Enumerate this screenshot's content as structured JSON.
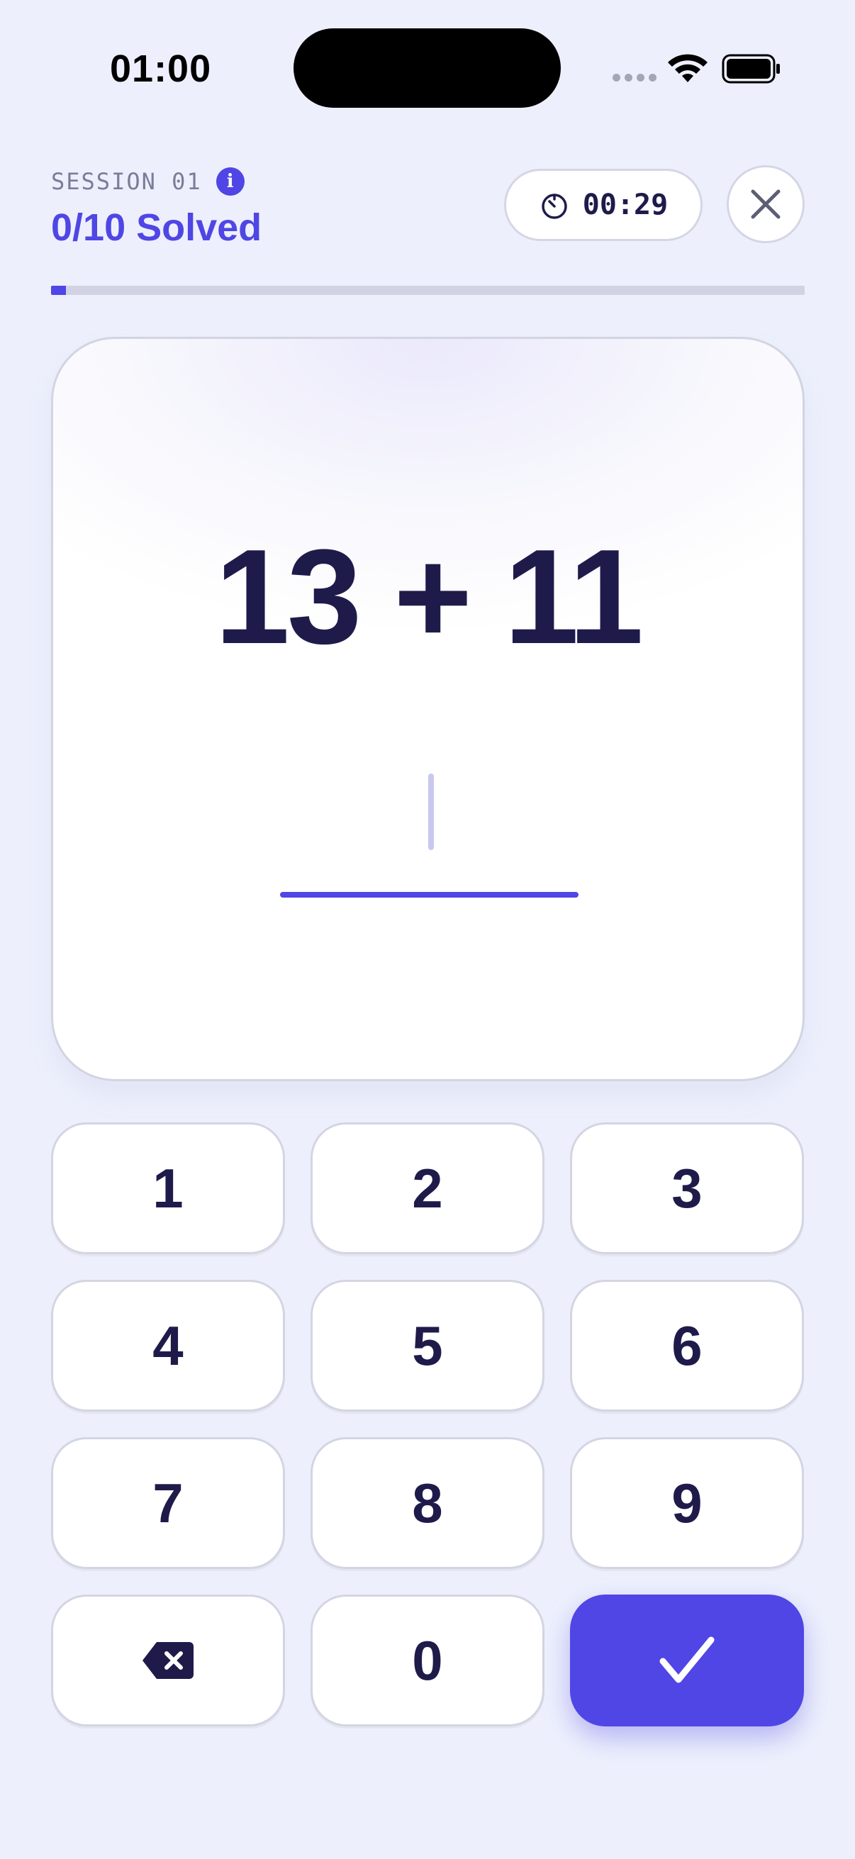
{
  "status_bar": {
    "time": "01:00",
    "icons": [
      "cellular-signal-icon",
      "wifi-icon",
      "battery-icon"
    ]
  },
  "header": {
    "session_label": "SESSION 01",
    "info_icon": "i",
    "solved_text": "0/10 Solved",
    "timer": "00:29",
    "close_icon": "close-icon"
  },
  "progress": {
    "fraction": 0.02
  },
  "problem": {
    "expression": "13 + 11",
    "answer_value": ""
  },
  "keypad": {
    "keys": [
      "1",
      "2",
      "3",
      "4",
      "5",
      "6",
      "7",
      "8",
      "9"
    ],
    "zero": "0",
    "backspace_icon": "backspace-icon",
    "submit_icon": "checkmark-icon"
  },
  "colors": {
    "accent": "#4f46e5",
    "background": "#edf0fc",
    "text_primary": "#1e1b4b",
    "text_muted": "#7a7d99"
  }
}
